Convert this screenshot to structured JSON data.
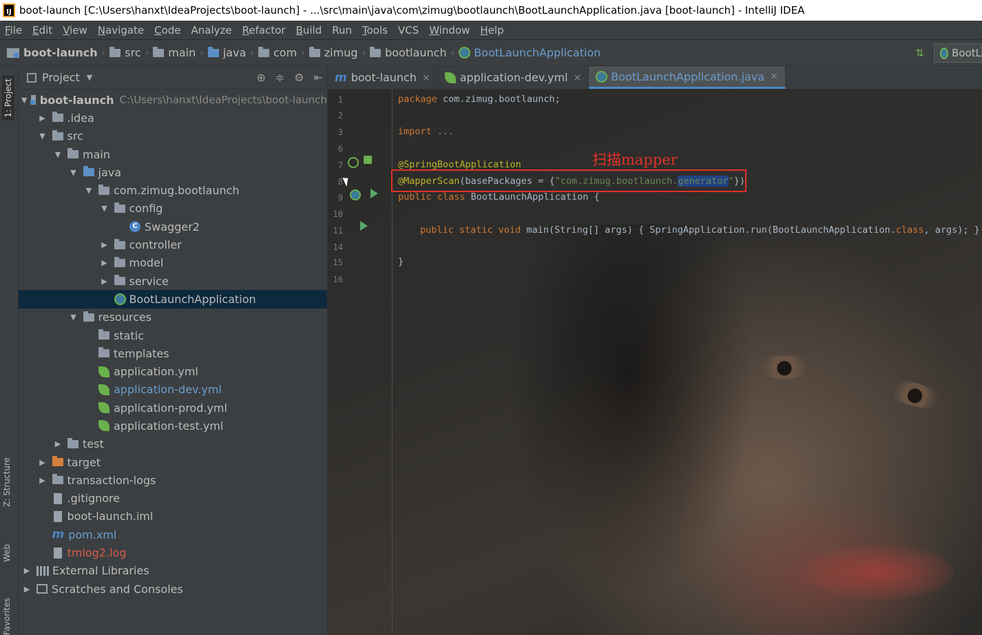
{
  "window": {
    "title": "boot-launch [C:\\Users\\hanxt\\IdeaProjects\\boot-launch] - ...\\src\\main\\java\\com\\zimug\\bootlaunch\\BootLaunchApplication.java [boot-launch] - IntelliJ IDEA"
  },
  "menu": [
    {
      "u": "F",
      "rest": "ile"
    },
    {
      "u": "E",
      "rest": "dit"
    },
    {
      "u": "V",
      "rest": "iew"
    },
    {
      "u": "N",
      "rest": "avigate"
    },
    {
      "u": "C",
      "rest": "ode"
    },
    {
      "u": "",
      "rest": "Analyze"
    },
    {
      "u": "R",
      "rest": "efactor"
    },
    {
      "u": "B",
      "rest": "uild"
    },
    {
      "u": "",
      "rest": "Run"
    },
    {
      "u": "T",
      "rest": "ools"
    },
    {
      "u": "",
      "rest": "VCS"
    },
    {
      "u": "W",
      "rest": "indow"
    },
    {
      "u": "H",
      "rest": "elp"
    }
  ],
  "breadcrumbs": [
    "boot-launch",
    "src",
    "main",
    "java",
    "com",
    "zimug",
    "bootlaunch",
    "BootLaunchApplication"
  ],
  "run_config_label": "BootL",
  "left_stripe": {
    "project_tab": "1: Project",
    "structure_tab": "Z: Structure",
    "web_tab": "Web",
    "favorites_tab": "Favorites"
  },
  "project_panel": {
    "title": "Project",
    "tree": [
      {
        "depth": 0,
        "arrow": "open",
        "icon": "module",
        "label": "boot-launch",
        "hint": "C:\\Users\\hanxt\\IdeaProjects\\boot-launch",
        "bold": true
      },
      {
        "depth": 1,
        "arrow": "closed",
        "icon": "folder",
        "label": ".idea"
      },
      {
        "depth": 1,
        "arrow": "open",
        "icon": "folder",
        "label": "src"
      },
      {
        "depth": 2,
        "arrow": "open",
        "icon": "folder",
        "label": "main"
      },
      {
        "depth": 3,
        "arrow": "open",
        "icon": "folder-blue",
        "label": "java"
      },
      {
        "depth": 4,
        "arrow": "open",
        "icon": "package",
        "label": "com.zimug.bootlaunch"
      },
      {
        "depth": 5,
        "arrow": "open",
        "icon": "package",
        "label": "config"
      },
      {
        "depth": 6,
        "arrow": "none",
        "icon": "class",
        "label": "Swagger2"
      },
      {
        "depth": 5,
        "arrow": "closed",
        "icon": "package",
        "label": "controller"
      },
      {
        "depth": 5,
        "arrow": "closed",
        "icon": "package",
        "label": "model"
      },
      {
        "depth": 5,
        "arrow": "closed",
        "icon": "package",
        "label": "service"
      },
      {
        "depth": 5,
        "arrow": "none",
        "icon": "spring",
        "label": "BootLaunchApplication",
        "selected": true
      },
      {
        "depth": 3,
        "arrow": "open",
        "icon": "resources",
        "label": "resources"
      },
      {
        "depth": 4,
        "arrow": "none",
        "icon": "package",
        "label": "static"
      },
      {
        "depth": 4,
        "arrow": "none",
        "icon": "package",
        "label": "templates"
      },
      {
        "depth": 4,
        "arrow": "none",
        "icon": "leaf",
        "label": "application.yml"
      },
      {
        "depth": 4,
        "arrow": "none",
        "icon": "leaf",
        "label": "application-dev.yml",
        "style": "link"
      },
      {
        "depth": 4,
        "arrow": "none",
        "icon": "leaf",
        "label": "application-prod.yml"
      },
      {
        "depth": 4,
        "arrow": "none",
        "icon": "leaf",
        "label": "application-test.yml"
      },
      {
        "depth": 2,
        "arrow": "closed",
        "icon": "folder",
        "label": "test"
      },
      {
        "depth": 1,
        "arrow": "closed",
        "icon": "folder-orange",
        "label": "target"
      },
      {
        "depth": 1,
        "arrow": "closed",
        "icon": "folder",
        "label": "transaction-logs"
      },
      {
        "depth": 1,
        "arrow": "none",
        "icon": "file",
        "label": ".gitignore"
      },
      {
        "depth": 1,
        "arrow": "none",
        "icon": "file",
        "label": "boot-launch.iml"
      },
      {
        "depth": 1,
        "arrow": "none",
        "icon": "maven",
        "label": "pom.xml",
        "style": "link"
      },
      {
        "depth": 1,
        "arrow": "none",
        "icon": "file",
        "label": "tmlog2.log",
        "style": "red"
      },
      {
        "depth": 0,
        "arrow": "closed",
        "icon": "library",
        "label": "External Libraries"
      },
      {
        "depth": 0,
        "arrow": "closed",
        "icon": "scratch",
        "label": "Scratches and Consoles"
      }
    ]
  },
  "editor": {
    "tabs": [
      {
        "label": "boot-launch",
        "icon": "maven",
        "active": false
      },
      {
        "label": "application-dev.yml",
        "icon": "leaf",
        "active": false
      },
      {
        "label": "BootLaunchApplication.java",
        "icon": "spring",
        "active": true
      }
    ],
    "line_numbers": [
      "1",
      "2",
      "3",
      "6",
      "7",
      "8",
      "9",
      "10",
      "11",
      "14",
      "15",
      "16"
    ],
    "annotation_label": "扫描mapper",
    "code": {
      "l1_kw": "package",
      "l1_rest": " com.zimug.bootlaunch;",
      "l3_kw": "import",
      "l3_fold": " ...",
      "l7_an": "@SpringBootApplication",
      "l8_an": "@MapperScan",
      "l8_rest": "(basePackages = {",
      "l8_str_a": "\"com.zimug.bootlaunch.",
      "l8_str_b": "generator",
      "l8_str_c": "\"",
      "l8_end": "})",
      "l9_kw": "public class",
      "l9_rest": " BootLaunchApplication {",
      "l11_kw": "public static void",
      "l11_rest": " main(String[] args) { SpringApplication.run(BootLaunchApplication.",
      "l11_kw2": "class",
      "l11_end": ", args); }",
      "l15": "}"
    }
  },
  "colors": {
    "accent": "#4a88c7",
    "selection": "#0d293e",
    "annotation_red": "#e0322a"
  }
}
